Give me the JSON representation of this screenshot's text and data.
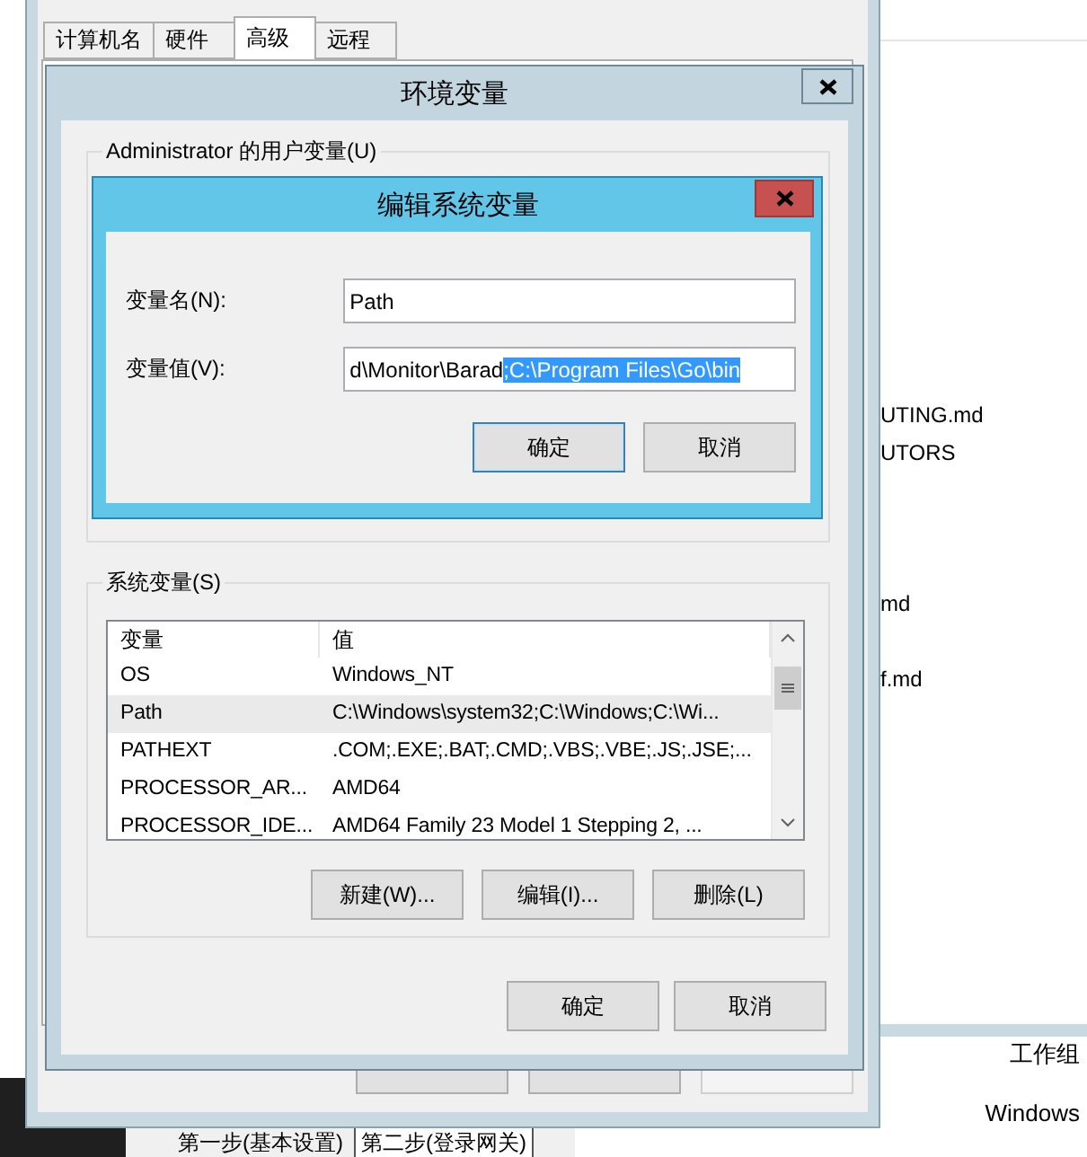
{
  "system_properties": {
    "tabs": [
      {
        "label": "计算机名",
        "selected": false
      },
      {
        "label": "硬件",
        "selected": false
      },
      {
        "label": "高级",
        "selected": true
      },
      {
        "label": "远程",
        "selected": false
      }
    ],
    "buttons": [
      {
        "disabled": false
      },
      {
        "disabled": false
      },
      {
        "disabled": true
      }
    ]
  },
  "environment_variables": {
    "title": "环境变量",
    "user_variables_label": "Administrator 的用户变量(U)",
    "system_variables": {
      "label": "系统变量(S)",
      "columns": [
        "变量",
        "值"
      ],
      "rows": [
        {
          "name": "OS",
          "value": "Windows_NT",
          "selected": false
        },
        {
          "name": "Path",
          "value": "C:\\Windows\\system32;C:\\Windows;C:\\Wi...",
          "selected": true
        },
        {
          "name": "PATHEXT",
          "value": ".COM;.EXE;.BAT;.CMD;.VBS;.VBE;.JS;.JSE;...",
          "selected": false
        },
        {
          "name": "PROCESSOR_AR...",
          "value": "AMD64",
          "selected": false
        },
        {
          "name": "PROCESSOR_IDE...",
          "value": "AMD64 Family 23 Model 1 Stepping 2, ...",
          "selected": false
        }
      ]
    },
    "list_buttons": [
      "新建(W)...",
      "编辑(I)...",
      "删除(L)"
    ],
    "buttons": [
      "确定",
      "取消"
    ]
  },
  "edit_dialog": {
    "title": "编辑系统变量",
    "fields": [
      {
        "label": "变量名(N):",
        "value": "Path"
      },
      {
        "label": "变量值(V):",
        "value": "d\\Monitor\\Barad",
        "selected_value": ";C:\\Program Files\\Go\\bin"
      }
    ],
    "buttons": [
      {
        "label": "确定",
        "focused": true
      },
      {
        "label": "取消",
        "focused": false
      }
    ]
  },
  "explorer": {
    "items": [
      "UTING.md",
      "UTORS",
      "md",
      "f.md"
    ],
    "details": [
      "工作组",
      "Windows"
    ]
  },
  "bottom_tabs": [
    {
      "label": "第一步(基本设置)",
      "selected": false
    },
    {
      "label": "第二步(登录网关)",
      "selected": true
    }
  ]
}
